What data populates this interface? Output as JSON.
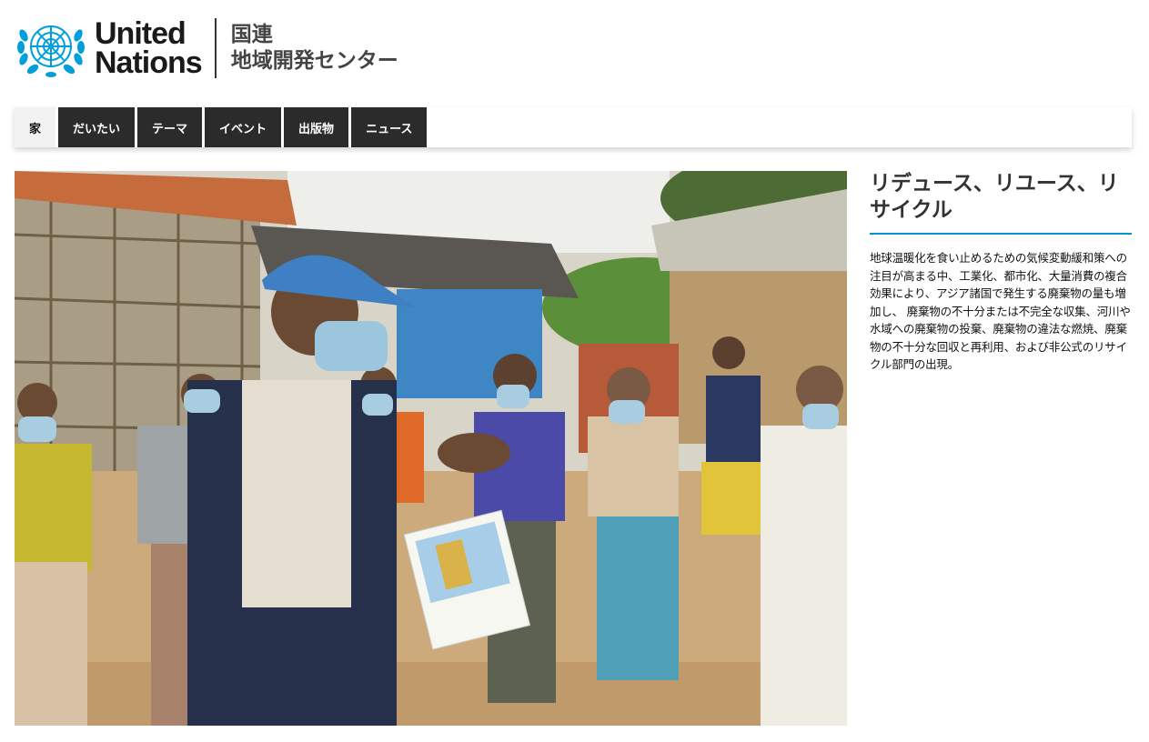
{
  "header": {
    "logo_icon": "un-emblem-icon",
    "wordmark_line1": "United",
    "wordmark_line2": "Nations",
    "center_line1": "国連",
    "center_line2": "地域開発センター",
    "brand_color": "#009edb"
  },
  "nav": {
    "items": [
      {
        "label": "家",
        "active": true
      },
      {
        "label": "だいたい"
      },
      {
        "label": "テーマ"
      },
      {
        "label": "イベント"
      },
      {
        "label": "出版物"
      },
      {
        "label": "ニュース"
      }
    ]
  },
  "article": {
    "title": "リデュース、リユース、リサイクル",
    "body": "地球温暖化を食い止めるための気候変動緩和策への注目が高まる中、工業化、都市化、大量消費の複合効果により、アジア諸国で発生する廃棄物の量も増加し、 廃棄物の不十分または不完全な収集、河川や水域への廃棄物の投棄、廃棄物の違法な燃焼、廃棄物の不十分な回収と再利用、および非公式のリサイクル部門の出現。",
    "accent_color": "#0a8fd1"
  }
}
